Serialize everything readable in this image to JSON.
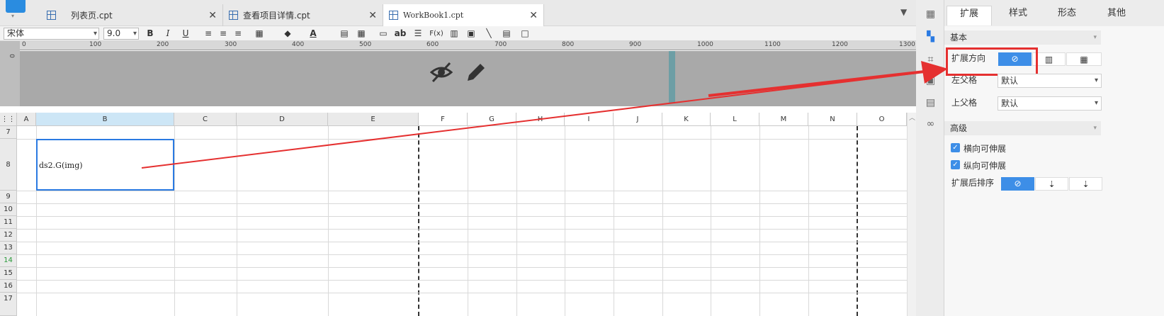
{
  "tabs": [
    {
      "label": "列表页.cpt",
      "close": "✕"
    },
    {
      "label": "查看项目详情.cpt",
      "close": "✕"
    },
    {
      "label": "WorkBook1.cpt",
      "close": "✕"
    }
  ],
  "toolbar": {
    "font_family": "宋体",
    "font_size": "9.0",
    "bold": "B",
    "italic": "I",
    "underline": "U",
    "text_color": "A",
    "wrap": "ab",
    "formula": "F(x)"
  },
  "ruler": {
    "ticks": [
      "0",
      "100",
      "200",
      "300",
      "400",
      "500",
      "600",
      "700",
      "800",
      "900",
      "1000",
      "1100",
      "1200",
      "1300"
    ],
    "vertical_tick": "0"
  },
  "grid": {
    "columns": [
      "A",
      "B",
      "C",
      "D",
      "E",
      "F",
      "G",
      "H",
      "I",
      "J",
      "K",
      "L",
      "M",
      "N",
      "O"
    ],
    "rows": [
      "7",
      "8",
      "9",
      "10",
      "11",
      "12",
      "13",
      "14",
      "15",
      "16",
      "17"
    ],
    "selected_cell_value": "ds2.G(img)"
  },
  "panel": {
    "tabs": [
      "扩展",
      "样式",
      "形态",
      "其他"
    ],
    "section_basic": "基本",
    "expand_direction_label": "扩展方向",
    "left_parent_label": "左父格",
    "left_parent_value": "默认",
    "upper_parent_label": "上父格",
    "upper_parent_value": "默认",
    "section_advanced": "高级",
    "h_expandable": "横向可伸展",
    "v_expandable": "纵向可伸展",
    "sort_label": "扩展后排序",
    "check": "✓",
    "chevron": "▾",
    "none_icon": "⊘"
  },
  "colors": {
    "accent": "#3d8ee7",
    "highlight": "#e53030",
    "selection": "#2a7ae2"
  }
}
